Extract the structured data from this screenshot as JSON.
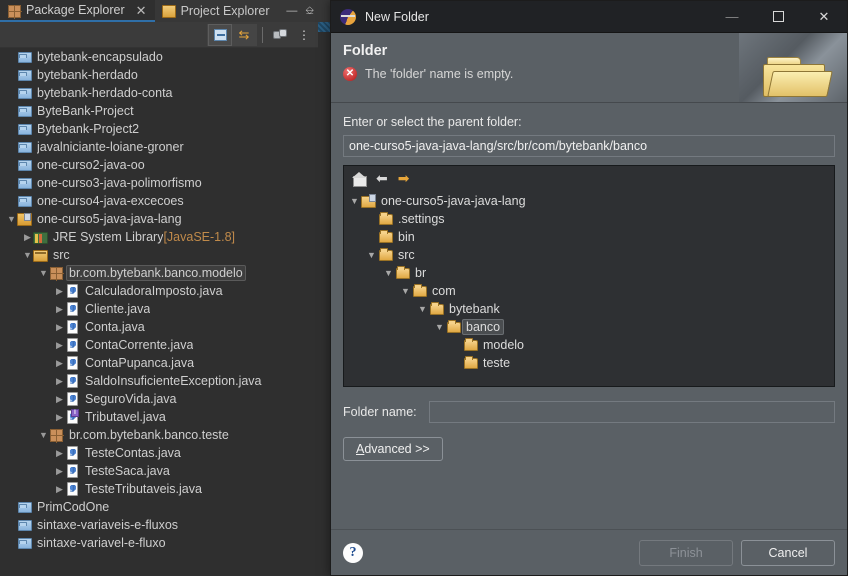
{
  "ide": {
    "tabs": [
      {
        "label": "Package Explorer",
        "icon": "package-explorer-icon",
        "active": true,
        "closable": true
      },
      {
        "label": "Project Explorer",
        "icon": "project-explorer-icon",
        "active": false,
        "closable": false
      }
    ],
    "window_controls": [
      {
        "name": "minimize-view-icon",
        "glyph": "—"
      },
      {
        "name": "maximize-view-icon",
        "glyph": "❐"
      }
    ],
    "toolbar": [
      {
        "name": "collapse-all-icon",
        "glyph": "collapse-all"
      },
      {
        "name": "link-with-editor-icon",
        "glyph": "link-arrows"
      },
      {
        "name": "view-filters-icon",
        "glyph": "filters"
      },
      {
        "name": "view-menu-icon",
        "glyph": "⋮"
      }
    ],
    "tree": [
      {
        "indent": 0,
        "arrow": "",
        "icon": "folder-closed-icon",
        "label": "bytebank-encapsulado",
        "type": "project"
      },
      {
        "indent": 0,
        "arrow": "",
        "icon": "folder-closed-icon",
        "label": "bytebank-herdado",
        "type": "project"
      },
      {
        "indent": 0,
        "arrow": "",
        "icon": "folder-closed-icon",
        "label": "bytebank-herdado-conta",
        "type": "project"
      },
      {
        "indent": 0,
        "arrow": "",
        "icon": "folder-closed-icon",
        "label": "ByteBank-Project",
        "type": "project"
      },
      {
        "indent": 0,
        "arrow": "",
        "icon": "folder-closed-icon",
        "label": "Bytebank-Project2",
        "type": "project"
      },
      {
        "indent": 0,
        "arrow": "",
        "icon": "folder-closed-icon",
        "label": "javalniciante-loiane-groner",
        "type": "project"
      },
      {
        "indent": 0,
        "arrow": "",
        "icon": "folder-closed-icon",
        "label": "one-curso2-java-oo",
        "type": "project"
      },
      {
        "indent": 0,
        "arrow": "",
        "icon": "folder-closed-icon",
        "label": "one-curso3-java-polimorfismo",
        "type": "project"
      },
      {
        "indent": 0,
        "arrow": "",
        "icon": "folder-closed-icon",
        "label": "one-curso4-java-excecoes",
        "type": "project"
      },
      {
        "indent": 0,
        "arrow": "▼",
        "icon": "java-project-open-icon",
        "label": "one-curso5-java-java-lang",
        "type": "project-open"
      },
      {
        "indent": 1,
        "arrow": "▶",
        "icon": "jre-library-icon",
        "label": "JRE System Library ",
        "suffix": "[JavaSE-1.8]",
        "type": "jre"
      },
      {
        "indent": 1,
        "arrow": "▼",
        "icon": "source-folder-icon",
        "label": "src",
        "type": "src"
      },
      {
        "indent": 2,
        "arrow": "▼",
        "icon": "package-icon",
        "label": "br.com.bytebank.banco.modelo",
        "type": "package",
        "selected": true
      },
      {
        "indent": 3,
        "arrow": "▶",
        "icon": "java-file-icon",
        "label": "CalculadoraImposto.java",
        "type": "java"
      },
      {
        "indent": 3,
        "arrow": "▶",
        "icon": "java-file-icon",
        "label": "Cliente.java",
        "type": "java"
      },
      {
        "indent": 3,
        "arrow": "▶",
        "icon": "java-file-icon",
        "label": "Conta.java",
        "type": "java"
      },
      {
        "indent": 3,
        "arrow": "▶",
        "icon": "java-file-icon",
        "label": "ContaCorrente.java",
        "type": "java"
      },
      {
        "indent": 3,
        "arrow": "▶",
        "icon": "java-file-icon",
        "label": "ContaPupanca.java",
        "type": "java"
      },
      {
        "indent": 3,
        "arrow": "▶",
        "icon": "java-file-icon",
        "label": "SaldoInsuficienteException.java",
        "type": "java"
      },
      {
        "indent": 3,
        "arrow": "▶",
        "icon": "java-file-icon",
        "label": "SeguroVida.java",
        "type": "java"
      },
      {
        "indent": 3,
        "arrow": "▶",
        "icon": "java-interface-icon",
        "label": "Tributavel.java",
        "type": "java-interface"
      },
      {
        "indent": 2,
        "arrow": "▼",
        "icon": "package-icon",
        "label": "br.com.bytebank.banco.teste",
        "type": "package"
      },
      {
        "indent": 3,
        "arrow": "▶",
        "icon": "java-file-icon",
        "label": "TesteContas.java",
        "type": "java"
      },
      {
        "indent": 3,
        "arrow": "▶",
        "icon": "java-file-icon",
        "label": "TesteSaca.java",
        "type": "java"
      },
      {
        "indent": 3,
        "arrow": "▶",
        "icon": "java-file-icon",
        "label": "TesteTributaveis.java",
        "type": "java"
      },
      {
        "indent": 0,
        "arrow": "",
        "icon": "folder-closed-icon",
        "label": "PrimCodOne",
        "type": "project"
      },
      {
        "indent": 0,
        "arrow": "",
        "icon": "folder-closed-icon",
        "label": "sintaxe-variaveis-e-fluxos",
        "type": "project"
      },
      {
        "indent": 0,
        "arrow": "",
        "icon": "folder-closed-icon",
        "label": "sintaxe-variavel-e-fluxo",
        "type": "project"
      }
    ]
  },
  "dialog": {
    "title": "New Folder",
    "titlebar_buttons": [
      {
        "name": "minimize-button",
        "glyph": "—"
      },
      {
        "name": "maximize-button",
        "glyph": "square"
      },
      {
        "name": "close-button",
        "glyph": "✕"
      }
    ],
    "header": {
      "heading": "Folder",
      "message": "The 'folder' name is empty.",
      "message_type": "error",
      "error_glyph": "✕"
    },
    "parent_folder": {
      "label": "Enter or select the parent folder:",
      "value": "one-curso5-java-java-lang/src/br/com/bytebank/banco",
      "placeholder": ""
    },
    "tree_toolbar": [
      {
        "name": "home-icon",
        "glyph": "home"
      },
      {
        "name": "back-arrow-icon",
        "glyph": "←"
      },
      {
        "name": "forward-arrow-icon",
        "glyph": "→"
      }
    ],
    "folder_tree": [
      {
        "indent": 0,
        "arrow": "▼",
        "icon": "project-open-icon",
        "label": "one-curso5-java-java-lang"
      },
      {
        "indent": 1,
        "arrow": "",
        "icon": "folder-open-icon",
        "label": ".settings"
      },
      {
        "indent": 1,
        "arrow": "",
        "icon": "folder-open-icon",
        "label": "bin"
      },
      {
        "indent": 1,
        "arrow": "▼",
        "icon": "folder-open-icon",
        "label": "src"
      },
      {
        "indent": 2,
        "arrow": "▼",
        "icon": "folder-open-icon",
        "label": "br"
      },
      {
        "indent": 3,
        "arrow": "▼",
        "icon": "folder-open-icon",
        "label": "com"
      },
      {
        "indent": 4,
        "arrow": "▼",
        "icon": "folder-open-icon",
        "label": "bytebank"
      },
      {
        "indent": 5,
        "arrow": "▼",
        "icon": "folder-open-icon",
        "label": "banco",
        "selected": true
      },
      {
        "indent": 6,
        "arrow": "",
        "icon": "folder-open-icon",
        "label": "modelo"
      },
      {
        "indent": 6,
        "arrow": "",
        "icon": "folder-open-icon",
        "label": "teste"
      }
    ],
    "folder_name": {
      "label": "Folder name:",
      "value": "",
      "placeholder": ""
    },
    "advanced_button": {
      "mnemonic": "A",
      "rest": "dvanced >>"
    },
    "footer": {
      "help_glyph": "?",
      "finish_label": "Finish",
      "finish_enabled": false,
      "cancel_label": "Cancel"
    }
  },
  "colors": {
    "ide_background": "#2f2f2f",
    "dialog_background": "#5a6065",
    "titlebar": "#202225",
    "tree_background": "#2e3033",
    "accent_tab": "#2f6fa8",
    "error_red": "#b01414",
    "suffix_orange": "#c08a4a"
  }
}
